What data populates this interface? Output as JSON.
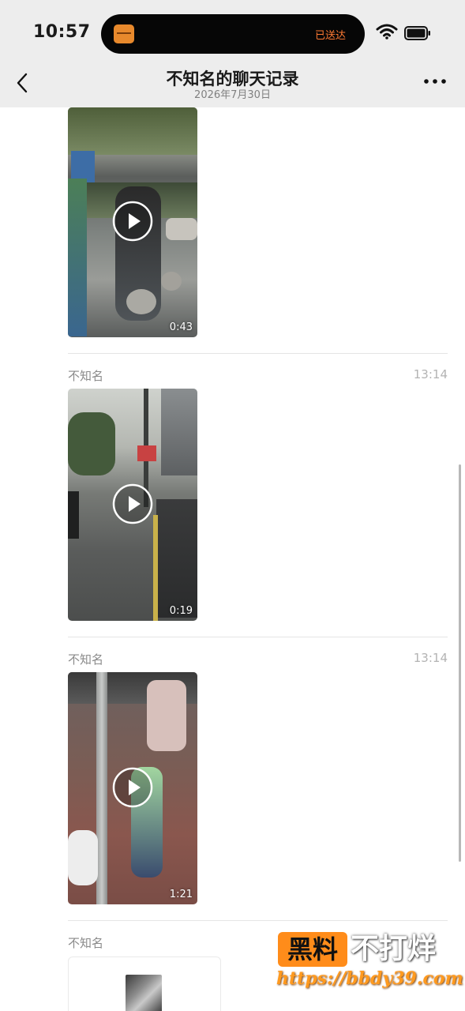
{
  "status_bar": {
    "time": "10:57",
    "island_status": "已送达",
    "accent_color": "#ff7a33"
  },
  "nav": {
    "title": "不知名的聊天记录",
    "subtitle": "2026年7月30日",
    "back_icon": "chevron-left-icon",
    "more_icon": "more-icon"
  },
  "messages": [
    {
      "sender": "",
      "time": "",
      "type": "video",
      "duration": "0:43"
    },
    {
      "sender": "不知名",
      "time": "13:14",
      "type": "video",
      "duration": "0:19"
    },
    {
      "sender": "不知名",
      "time": "13:14",
      "type": "video",
      "duration": "1:21"
    },
    {
      "sender": "不知名",
      "time": "",
      "type": "chat-record"
    }
  ],
  "watermark": {
    "badge": "黑料",
    "text": "不打烊",
    "url": "https://bbdy39.com"
  }
}
